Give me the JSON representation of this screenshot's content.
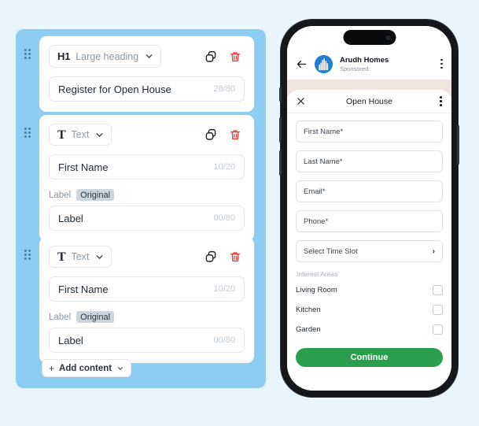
{
  "theme": {
    "page_bg": "#e8f5fd",
    "panel_bg": "#8ecdf2",
    "accent_green": "#2aa04f",
    "delete_red": "#f0322e",
    "brand_blue": "#1f7fd4",
    "feed_strip": "#efe4de"
  },
  "editor": {
    "blocks": [
      {
        "type_tag": "H1",
        "type_name": "Large heading",
        "value": "Register for Open House",
        "counter": "28/80",
        "has_label": false,
        "duplicate_icon": "duplicate-icon",
        "delete_icon": "trash-icon",
        "drag_icon": "drag-handle-icon"
      },
      {
        "type_tag": "T",
        "type_name": "Text",
        "value": "First Name",
        "counter": "10/20",
        "has_label": true,
        "label_text": "Label",
        "label_badge": "Original",
        "label_value": "Label",
        "label_counter": "00/80",
        "duplicate_icon": "duplicate-icon",
        "delete_icon": "trash-icon",
        "drag_icon": "drag-handle-icon"
      },
      {
        "type_tag": "T",
        "type_name": "Text",
        "value": "First Name",
        "counter": "10/20",
        "has_label": true,
        "label_text": "Label",
        "label_badge": "Original",
        "label_value": "Label",
        "label_counter": "00/80",
        "duplicate_icon": "duplicate-icon",
        "delete_icon": "trash-icon",
        "drag_icon": "drag-handle-icon"
      }
    ],
    "add_content": {
      "plus": "+",
      "label": "Add content",
      "chevron_icon": "chevron-down-icon"
    }
  },
  "phone": {
    "app_bar": {
      "back_icon": "back-arrow-icon",
      "logo_icon": "brand-logo-icon",
      "brand_name": "Arudh Homes",
      "brand_sub": "Sponsored",
      "menu_icon": "kebab-menu-icon"
    },
    "modal": {
      "close_icon": "close-icon",
      "title": "Open House",
      "menu_icon": "kebab-menu-icon",
      "fields": [
        {
          "placeholder": "First Name*",
          "kind": "text"
        },
        {
          "placeholder": "Last Name*",
          "kind": "text"
        },
        {
          "placeholder": "Email*",
          "kind": "text"
        },
        {
          "placeholder": "Phone*",
          "kind": "text"
        },
        {
          "placeholder": "Select Time Slot",
          "kind": "picker",
          "arrow": "›"
        }
      ],
      "interest_heading": "Interest Areas",
      "interests": [
        {
          "label": "Living Room",
          "checked": false
        },
        {
          "label": "Kitchen",
          "checked": false
        },
        {
          "label": "Garden",
          "checked": false
        }
      ],
      "submit_label": "Continue"
    }
  }
}
